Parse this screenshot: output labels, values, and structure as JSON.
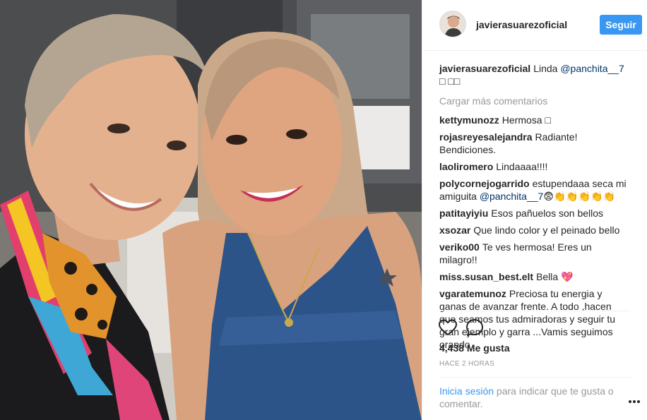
{
  "post": {
    "username": "javierasuarezoficial",
    "follow_label": "Seguir",
    "caption": {
      "user": "javierasuarezoficial",
      "text": "Linda",
      "mention": "@panchita__7",
      "trailing": "□ □□"
    },
    "load_more": "Cargar más comentarios",
    "comments": [
      {
        "user": "kettymunozz",
        "text": "Hermosa □"
      },
      {
        "user": "rojasreyesalejandra",
        "text": "Radiante! Bendiciones."
      },
      {
        "user": "laoliromero",
        "text": "Lindaaaa!!!!"
      },
      {
        "user": "polycornejogarrido",
        "text": "estupendaaa seca mi amiguita",
        "mention": "@panchita__7",
        "trailing": "😨👏👏👏👏👏"
      },
      {
        "user": "patitayiyiu",
        "text": "Esos pañuelos son bellos"
      },
      {
        "user": "xsozar",
        "text": "Que lindo color y el peinado bello"
      },
      {
        "user": "veriko00",
        "text": "Te ves hermosa! Eres un milagro!!"
      },
      {
        "user": "miss.susan_best.elt",
        "text": "Bella 💖"
      },
      {
        "user": "vgaratemunoz",
        "text": "Preciosa tu energia y ganas de avanzar frente. A todo ,hacen que seamos tus admiradoras y seguir tu gran ejemplo y garra ...Vamis seguimos orando"
      }
    ],
    "likes": "4,438 Me gusta",
    "timestamp": "HACE 2 HORAS",
    "login_link": "Inicia sesión",
    "login_text": " para indicar que te gusta o comentar.",
    "icons": {
      "like": "heart-icon",
      "comment": "comment-bubble-icon",
      "more": "more-options-icon"
    },
    "colors": {
      "accent": "#3897f0",
      "mention": "#003569",
      "muted": "#999999"
    }
  }
}
